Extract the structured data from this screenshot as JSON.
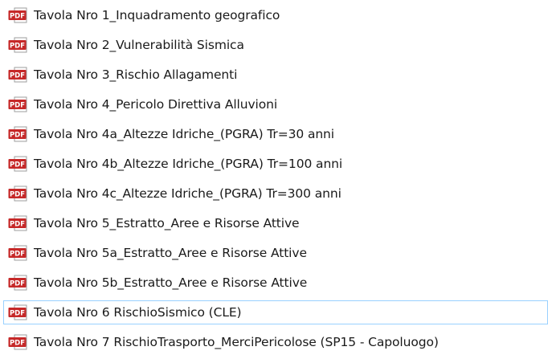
{
  "file_list": {
    "icon": "pdf-file-icon",
    "icon_label": "PDF",
    "icon_colors": {
      "badge": "#c62828",
      "page": "#ffffff",
      "border": "#9e9e9e",
      "text": "#ffffff"
    },
    "focused_index": 10,
    "focus_border_color": "#99d1ff",
    "items": [
      {
        "name": "Tavola Nro 1_Inquadramento geografico"
      },
      {
        "name": "Tavola Nro 2_Vulnerabilità Sismica"
      },
      {
        "name": "Tavola Nro 3_Rischio Allagamenti"
      },
      {
        "name": "Tavola Nro 4_Pericolo Direttiva Alluvioni"
      },
      {
        "name": "Tavola Nro 4a_Altezze Idriche_(PGRA) Tr=30 anni"
      },
      {
        "name": "Tavola Nro 4b_Altezze Idriche_(PGRA) Tr=100 anni"
      },
      {
        "name": "Tavola Nro 4c_Altezze Idriche_(PGRA) Tr=300 anni"
      },
      {
        "name": "Tavola Nro 5_Estratto_Aree e Risorse Attive"
      },
      {
        "name": "Tavola Nro 5a_Estratto_Aree e Risorse Attive"
      },
      {
        "name": "Tavola Nro 5b_Estratto_Aree e Risorse Attive"
      },
      {
        "name": "Tavola Nro 6 RischioSismico (CLE)"
      },
      {
        "name": "Tavola Nro 7 RischioTrasporto_MerciPericolose (SP15 - Capoluogo)"
      }
    ]
  }
}
